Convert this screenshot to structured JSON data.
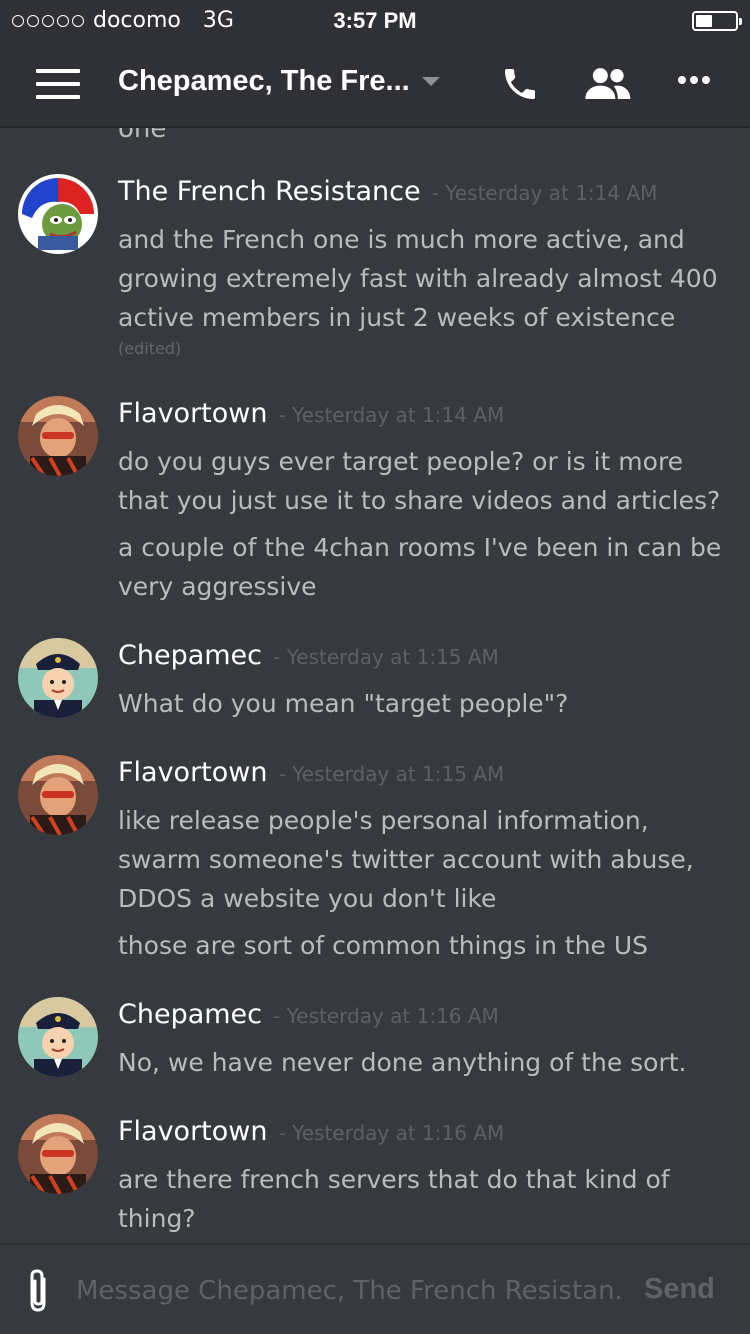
{
  "status_bar": {
    "carrier": "docomo",
    "network": "3G",
    "time": "3:57 PM"
  },
  "header": {
    "channel_title": "Chepamec, The Fre..."
  },
  "partial_prev_text": "one",
  "messages": [
    {
      "author": "The French Resistance",
      "timestamp": "- Yesterday at 1:14 AM",
      "lines": [
        "and the French one is much more active, and",
        "growing extremely fast with already almost 400",
        "active members in just 2 weeks of existence"
      ],
      "edited": "(edited)"
    },
    {
      "author": "Flavortown",
      "timestamp": "- Yesterday at 1:14 AM",
      "lines": [
        "do you guys ever target people? or is it more",
        "that you just use it to share videos and articles?",
        "a couple of the 4chan rooms I've been in can be",
        "very aggressive"
      ]
    },
    {
      "author": "Chepamec",
      "timestamp": "- Yesterday at 1:15 AM",
      "lines": [
        "What do you mean \"target people\"?"
      ]
    },
    {
      "author": "Flavortown",
      "timestamp": "- Yesterday at 1:15 AM",
      "lines": [
        "like release people's personal information,",
        "swarm someone's twitter account with abuse,",
        "DDOS a website you don't like",
        "those are sort of common things in the US"
      ]
    },
    {
      "author": "Chepamec",
      "timestamp": "- Yesterday at 1:16 AM",
      "lines": [
        "No, we have never done anything of the sort."
      ]
    },
    {
      "author": "Flavortown",
      "timestamp": "- Yesterday at 1:16 AM",
      "lines": [
        "are there french servers that do that kind of",
        "thing?"
      ]
    }
  ],
  "composer": {
    "placeholder": "Message Chepamec, The French Resistan...",
    "send_label": "Send"
  },
  "colors": {
    "background": "#36393e",
    "header_bg": "#2f3136",
    "username": "#ffffff",
    "message_text": "#b9bbbe",
    "timestamp": "#5d6066"
  }
}
